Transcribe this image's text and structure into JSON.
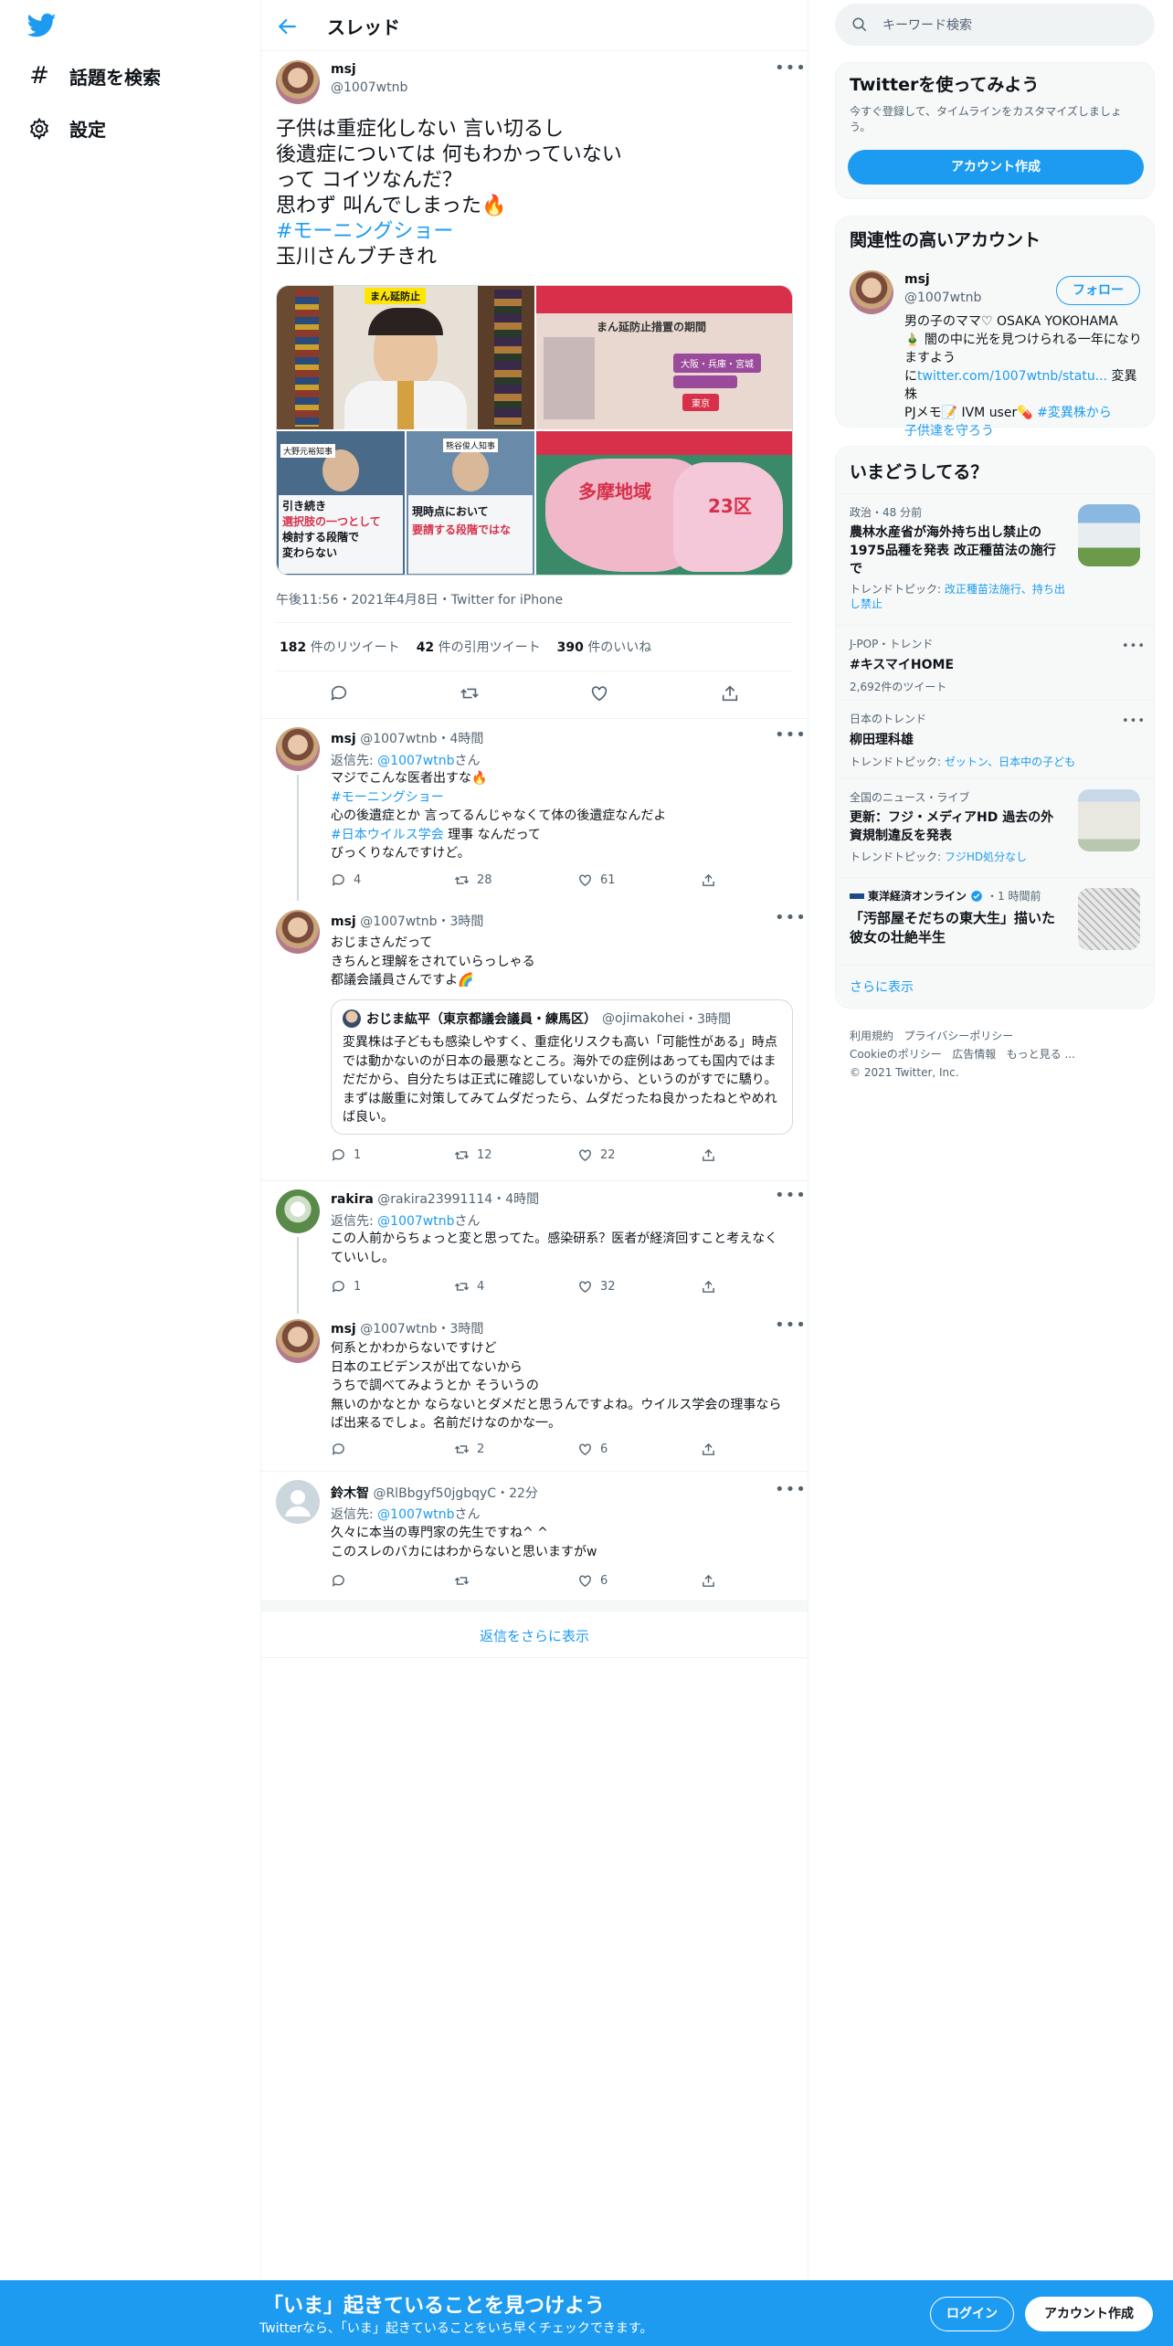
{
  "nav": {
    "explore_label": "話題を検索",
    "settings_label": "設定"
  },
  "header": {
    "title": "スレッド"
  },
  "main_tweet": {
    "name": "msj",
    "handle": "@1007wtnb",
    "lines": [
      "子供は重症化しない 言い切るし",
      "後遺症については 何もわかっていない",
      "って コイツなんだ？",
      "思わず 叫んでしまった🔥"
    ],
    "hashtag": "#モーニングショー",
    "last_line": "玉川さんブチきれ",
    "media": {
      "tl_caption": "まん延防止",
      "tr_caption": "まん延防止措置の期間",
      "tr_items": [
        "大阪・兵庫・宮城",
        "東京"
      ],
      "bl1_name": "大野元裕知事",
      "bl1_text": [
        "引き続き",
        "選択肢の一つとして",
        "検討する段階で",
        "変わらない"
      ],
      "bl2_name": "熊谷俊人知事",
      "bl2_text": [
        "現時点において",
        "要請する段階ではな"
      ],
      "br_map_labels": [
        "多摩地域",
        "23区"
      ]
    },
    "timestamp": "午後11:56・2021年4月8日・Twitter for iPhone",
    "retweets_count": "182",
    "retweets_label": "件のリツイート",
    "quotes_count": "42",
    "quotes_label": "件の引用ツイート",
    "likes_count": "390",
    "likes_label": "件のいいね"
  },
  "replies": [
    {
      "name": "msj",
      "handle": "@1007wtnb",
      "time": "・4時間",
      "reply_to_label": "返信先: ",
      "reply_to": "@1007wtnb",
      "reply_suffix": "さん",
      "lines": [
        "マジでこんな医者出すな🔥"
      ],
      "hashtag1": "#モーニングショー",
      "line3": "心の後遺症とか 言ってるんじゃなくて体の後遺症なんだよ",
      "hashtag2": "#日本ウイルス学会",
      "line4_suffix": " 理事 なんだって",
      "line5": "びっくりなんですけど。",
      "replies": "4",
      "retweets": "28",
      "likes": "61"
    },
    {
      "name": "msj",
      "handle": "@1007wtnb",
      "time": "・3時間",
      "lines": [
        "おじまさんだって",
        "きちんと理解をされていらっしゃる",
        "都議会議員さんですよ🌈"
      ],
      "quote": {
        "name": "おじま紘平（東京都議会議員・練馬区）",
        "handle": "@ojimakohei",
        "time": "・3時間",
        "text": "変異株は子どもも感染しやすく、重症化リスクも高い「可能性がある」時点では動かないのが日本の最悪なところ。海外での症例はあっても国内ではまだだから、自分たちは正式に確認していないから、というのがすでに驕り。まずは厳重に対策してみてムダだったら、ムダだったね良かったねとやめれば良い。"
      },
      "replies": "1",
      "retweets": "12",
      "likes": "22"
    },
    {
      "name": "rakira",
      "handle": "@rakira23991114",
      "time": "・4時間",
      "reply_to_label": "返信先: ",
      "reply_to": "@1007wtnb",
      "reply_suffix": "さん",
      "text": "この人前からちょっと変と思ってた。感染研系？医者が経済回すこと考えなくていいし。",
      "replies": "1",
      "retweets": "4",
      "likes": "32"
    },
    {
      "name": "msj",
      "handle": "@1007wtnb",
      "time": "・3時間",
      "lines": [
        "何系とかわからないですけど",
        "日本のエビデンスが出てないから",
        "うちで調べてみようとか そういうの"
      ],
      "text": "無いのかなとか ならないとダメだと思うんですよね。ウイルス学会の理事ならば出来るでしょ。名前だけなのかな一。",
      "replies": "",
      "retweets": "2",
      "likes": "6"
    },
    {
      "name": "鈴木智",
      "handle": "@RlBbgyf50jgbqyC",
      "time": "・22分",
      "reply_to_label": "返信先: ",
      "reply_to": "@1007wtnb",
      "reply_suffix": "さん",
      "lines": [
        "久々に本当の専門家の先生ですね^ ^",
        "このスレのバカにはわからないと思いますがw"
      ],
      "replies": "",
      "retweets": "",
      "likes": "6"
    }
  ],
  "show_more_replies": "返信をさらに表示",
  "sidebar": {
    "search_placeholder": "キーワード検索",
    "signup": {
      "title": "Twitterを使ってみよう",
      "subtitle": "今すぐ登録して、タイムラインをカスタマイズしましょう。",
      "button": "アカウント作成"
    },
    "related": {
      "title": "関連性の高いアカウント",
      "name": "msj",
      "handle": "@1007wtnb",
      "follow": "フォロー",
      "bio1": "男の子のママ♡ OSAKA YOKOHAMA",
      "bio2": "🎍 闇の中に光を見つけられる一年になりますよう",
      "bio3_prefix": "に",
      "bio3_link": "twitter.com/1007wtnb/statu...",
      "bio3_suffix": " 変異株",
      "bio4_prefix": "PJメモ📝 IVM user💊 ",
      "bio4_link": "#変異株から",
      "bio5_link": "子供達を守ろう"
    },
    "trends": {
      "title": "いまどうしてる？",
      "items": [
        {
          "meta": "政治・48 分前",
          "title": "農林水産省が海外持ち出し禁止の1975品種を発表 改正種苗法の施行で",
          "tr_prefix": "トレンドトピック: ",
          "tr_link": "改正種苗法施行、持ち出し禁止"
        },
        {
          "meta": "J-POP・トレンド",
          "title": "#キスマイHOME",
          "count": "2,692件のツイート"
        },
        {
          "meta": "日本のトレンド",
          "title": "柳田理科雄",
          "tr_prefix": "トレンドトピック: ",
          "tr_link": "ゼットン、日本中の子ども"
        },
        {
          "meta": "全国のニュース・ライブ",
          "title": "更新：フジ・メディアHD 過去の外資規制違反を発表",
          "tr_prefix": "トレンドトピック: ",
          "tr_link": "フジHD処分なし"
        },
        {
          "meta_name": "東洋経済オンライン",
          "meta_time": "・1 時間前",
          "title": "「汚部屋そだちの東大生」描いた彼女の壮絶半生"
        }
      ],
      "show_more": "さらに表示"
    },
    "footer": {
      "links1": [
        "利用規約",
        "プライバシーポリシー"
      ],
      "links2": [
        "Cookieのポリシー",
        "広告情報",
        "もっと見る ..."
      ],
      "copyright": "© 2021 Twitter, Inc."
    }
  },
  "bottom_bar": {
    "title": "「いま」起きていることを見つけよう",
    "subtitle": "Twitterなら、「いま」起きていることをいち早くチェックできます。",
    "login": "ログイン",
    "signup": "アカウント作成"
  },
  "colors": {
    "accent": "#1d9bf0",
    "text": "#0f1419",
    "secondary": "#536471",
    "sidebar_bg": "#f7f9f9",
    "border": "#eff3f4"
  }
}
